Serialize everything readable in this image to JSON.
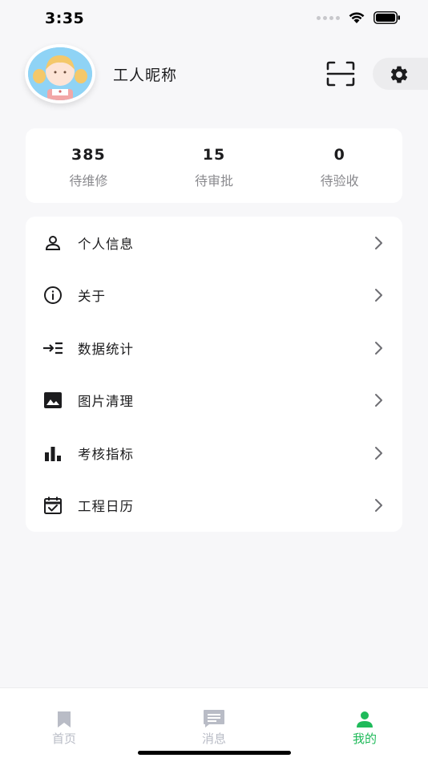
{
  "status_bar": {
    "time": "3:35"
  },
  "profile": {
    "nickname": "工人昵称"
  },
  "stats": [
    {
      "value": "385",
      "label": "待维修"
    },
    {
      "value": "15",
      "label": "待审批"
    },
    {
      "value": "0",
      "label": "待验收"
    }
  ],
  "menu": [
    {
      "label": "个人信息",
      "icon": "person-icon"
    },
    {
      "label": "关于",
      "icon": "info-icon"
    },
    {
      "label": "数据统计",
      "icon": "arrow-list-icon"
    },
    {
      "label": "图片清理",
      "icon": "image-icon"
    },
    {
      "label": "考核指标",
      "icon": "bar-chart-icon"
    },
    {
      "label": "工程日历",
      "icon": "calendar-check-icon"
    }
  ],
  "tabs": [
    {
      "label": "首页",
      "icon": "bookmark-icon",
      "active": false
    },
    {
      "label": "消息",
      "icon": "message-icon",
      "active": false
    },
    {
      "label": "我的",
      "icon": "person-icon",
      "active": true
    }
  ],
  "colors": {
    "accent": "#1fba5a",
    "background": "#f7f7f9",
    "inactive_tab": "#b9bcc6"
  }
}
